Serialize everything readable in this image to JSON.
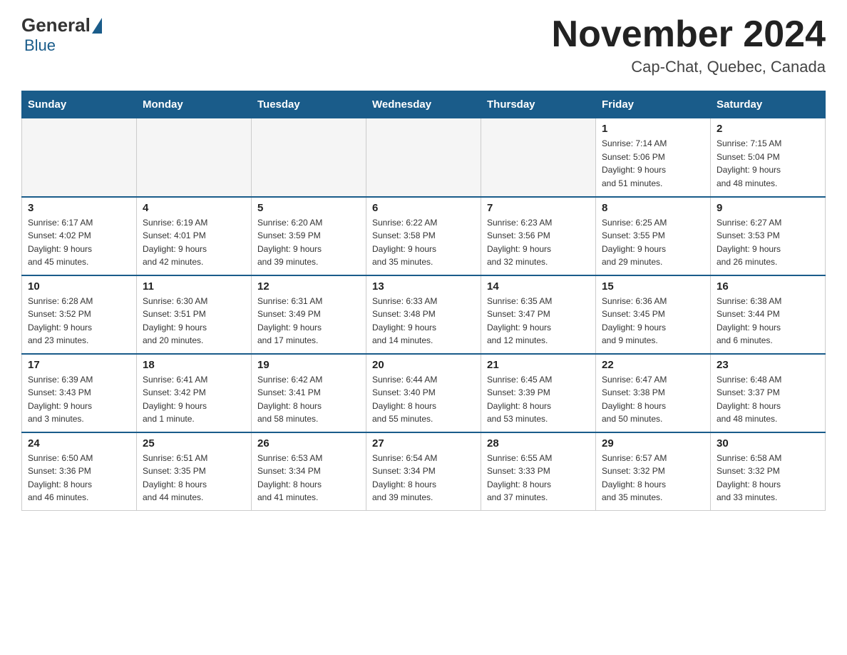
{
  "logo": {
    "general": "General",
    "blue": "Blue"
  },
  "header": {
    "month_year": "November 2024",
    "location": "Cap-Chat, Quebec, Canada"
  },
  "weekdays": [
    "Sunday",
    "Monday",
    "Tuesday",
    "Wednesday",
    "Thursday",
    "Friday",
    "Saturday"
  ],
  "weeks": [
    [
      {
        "day": "",
        "info": ""
      },
      {
        "day": "",
        "info": ""
      },
      {
        "day": "",
        "info": ""
      },
      {
        "day": "",
        "info": ""
      },
      {
        "day": "",
        "info": ""
      },
      {
        "day": "1",
        "info": "Sunrise: 7:14 AM\nSunset: 5:06 PM\nDaylight: 9 hours\nand 51 minutes."
      },
      {
        "day": "2",
        "info": "Sunrise: 7:15 AM\nSunset: 5:04 PM\nDaylight: 9 hours\nand 48 minutes."
      }
    ],
    [
      {
        "day": "3",
        "info": "Sunrise: 6:17 AM\nSunset: 4:02 PM\nDaylight: 9 hours\nand 45 minutes."
      },
      {
        "day": "4",
        "info": "Sunrise: 6:19 AM\nSunset: 4:01 PM\nDaylight: 9 hours\nand 42 minutes."
      },
      {
        "day": "5",
        "info": "Sunrise: 6:20 AM\nSunset: 3:59 PM\nDaylight: 9 hours\nand 39 minutes."
      },
      {
        "day": "6",
        "info": "Sunrise: 6:22 AM\nSunset: 3:58 PM\nDaylight: 9 hours\nand 35 minutes."
      },
      {
        "day": "7",
        "info": "Sunrise: 6:23 AM\nSunset: 3:56 PM\nDaylight: 9 hours\nand 32 minutes."
      },
      {
        "day": "8",
        "info": "Sunrise: 6:25 AM\nSunset: 3:55 PM\nDaylight: 9 hours\nand 29 minutes."
      },
      {
        "day": "9",
        "info": "Sunrise: 6:27 AM\nSunset: 3:53 PM\nDaylight: 9 hours\nand 26 minutes."
      }
    ],
    [
      {
        "day": "10",
        "info": "Sunrise: 6:28 AM\nSunset: 3:52 PM\nDaylight: 9 hours\nand 23 minutes."
      },
      {
        "day": "11",
        "info": "Sunrise: 6:30 AM\nSunset: 3:51 PM\nDaylight: 9 hours\nand 20 minutes."
      },
      {
        "day": "12",
        "info": "Sunrise: 6:31 AM\nSunset: 3:49 PM\nDaylight: 9 hours\nand 17 minutes."
      },
      {
        "day": "13",
        "info": "Sunrise: 6:33 AM\nSunset: 3:48 PM\nDaylight: 9 hours\nand 14 minutes."
      },
      {
        "day": "14",
        "info": "Sunrise: 6:35 AM\nSunset: 3:47 PM\nDaylight: 9 hours\nand 12 minutes."
      },
      {
        "day": "15",
        "info": "Sunrise: 6:36 AM\nSunset: 3:45 PM\nDaylight: 9 hours\nand 9 minutes."
      },
      {
        "day": "16",
        "info": "Sunrise: 6:38 AM\nSunset: 3:44 PM\nDaylight: 9 hours\nand 6 minutes."
      }
    ],
    [
      {
        "day": "17",
        "info": "Sunrise: 6:39 AM\nSunset: 3:43 PM\nDaylight: 9 hours\nand 3 minutes."
      },
      {
        "day": "18",
        "info": "Sunrise: 6:41 AM\nSunset: 3:42 PM\nDaylight: 9 hours\nand 1 minute."
      },
      {
        "day": "19",
        "info": "Sunrise: 6:42 AM\nSunset: 3:41 PM\nDaylight: 8 hours\nand 58 minutes."
      },
      {
        "day": "20",
        "info": "Sunrise: 6:44 AM\nSunset: 3:40 PM\nDaylight: 8 hours\nand 55 minutes."
      },
      {
        "day": "21",
        "info": "Sunrise: 6:45 AM\nSunset: 3:39 PM\nDaylight: 8 hours\nand 53 minutes."
      },
      {
        "day": "22",
        "info": "Sunrise: 6:47 AM\nSunset: 3:38 PM\nDaylight: 8 hours\nand 50 minutes."
      },
      {
        "day": "23",
        "info": "Sunrise: 6:48 AM\nSunset: 3:37 PM\nDaylight: 8 hours\nand 48 minutes."
      }
    ],
    [
      {
        "day": "24",
        "info": "Sunrise: 6:50 AM\nSunset: 3:36 PM\nDaylight: 8 hours\nand 46 minutes."
      },
      {
        "day": "25",
        "info": "Sunrise: 6:51 AM\nSunset: 3:35 PM\nDaylight: 8 hours\nand 44 minutes."
      },
      {
        "day": "26",
        "info": "Sunrise: 6:53 AM\nSunset: 3:34 PM\nDaylight: 8 hours\nand 41 minutes."
      },
      {
        "day": "27",
        "info": "Sunrise: 6:54 AM\nSunset: 3:34 PM\nDaylight: 8 hours\nand 39 minutes."
      },
      {
        "day": "28",
        "info": "Sunrise: 6:55 AM\nSunset: 3:33 PM\nDaylight: 8 hours\nand 37 minutes."
      },
      {
        "day": "29",
        "info": "Sunrise: 6:57 AM\nSunset: 3:32 PM\nDaylight: 8 hours\nand 35 minutes."
      },
      {
        "day": "30",
        "info": "Sunrise: 6:58 AM\nSunset: 3:32 PM\nDaylight: 8 hours\nand 33 minutes."
      }
    ]
  ]
}
